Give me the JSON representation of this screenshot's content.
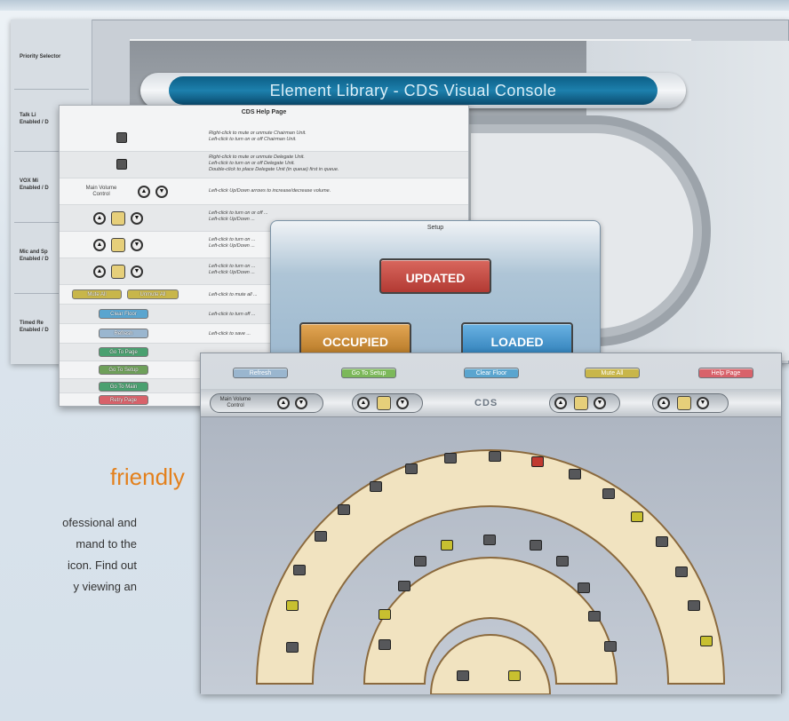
{
  "back": {
    "title": "Element Library - CDS Visual Console",
    "left_items": [
      {
        "label": "Priority Selector"
      },
      {
        "label": "Talk Li",
        "sub": "Enabled / D"
      },
      {
        "label": "VOX Mi",
        "sub": "Enabled / D"
      },
      {
        "label": "Mic and Sp",
        "sub": "Enabled / D"
      },
      {
        "label": "Timed Re",
        "sub": "Enabled / D"
      }
    ]
  },
  "help": {
    "title": "CDS Help Page",
    "main_volume": "Main Volume\nControl",
    "rows": [
      {
        "desc": "Right-click to mute or unmute Chairman Unit.\nLeft-click to turn on or off Chairman Unit."
      },
      {
        "desc": "Right-click to mute or unmute Delegate Unit.\nLeft-click to turn on or off Delegate Unit.\nDouble-click to place Delegate Unit (in queue) first in queue."
      },
      {
        "desc": "Left-click Up/Down arrows to increase/decrease volume."
      },
      {
        "desc": "Left-click to turn on or off ...\nLeft-click Up/Down ..."
      },
      {
        "desc": "Left-click to turn on ...\nLeft-click Up/Down ..."
      },
      {
        "desc": "Left-click to turn on ...\nLeft-click Up/Down ..."
      },
      {
        "desc": "Left-click to mute all ..."
      },
      {
        "desc": "Left-click to turn off ..."
      },
      {
        "desc": "Left-click to save ..."
      }
    ],
    "buttons": [
      "Mute All",
      "Unmute All",
      "Clear Floor",
      "Refresh",
      "Go To Page",
      "Go To Setup",
      "Go To Main",
      "Retry Page"
    ]
  },
  "setup": {
    "title": "Setup",
    "updated": "UPDATED",
    "occupied": "OCCUPIED",
    "loaded": "LOADED"
  },
  "front": {
    "buttons": [
      {
        "label": "Refresh",
        "color": "#9ab6cf"
      },
      {
        "label": "Go To Setup",
        "color": "#7cb85a"
      },
      {
        "label": "Clear Floor",
        "color": "#5aa5cf"
      },
      {
        "label": "Mute All",
        "color": "#c8b64a"
      },
      {
        "label": "Help Page",
        "color": "#d8626a"
      }
    ],
    "main_volume": "Main Volume\nControl",
    "center_label": "CDS"
  },
  "marketing": {
    "heading": "friendly",
    "lines": [
      "ofessional and",
      "mand to the",
      "icon. Find out",
      "y viewing an"
    ]
  },
  "colors": {
    "accent_orange": "#e3801c",
    "title_blue": "#1d80ad",
    "updated_red": "#c0473f",
    "occupied_orange": "#c98a3a",
    "loaded_blue": "#3e8ec9",
    "floor_beige": "#f1e3c0"
  }
}
